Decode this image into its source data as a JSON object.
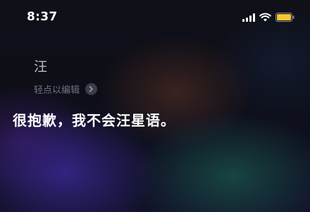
{
  "status_bar": {
    "time": "8:37",
    "battery_color": "#f7c531",
    "icons": [
      "signal-icon",
      "wifi-icon",
      "battery-icon"
    ]
  },
  "siri": {
    "query": "汪",
    "edit_hint": "轻点以编辑",
    "response": "很抱歉，我不会汪星语。"
  }
}
